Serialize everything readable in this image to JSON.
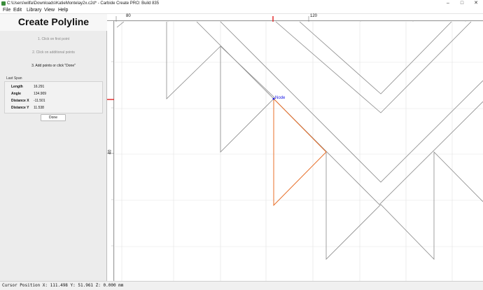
{
  "window": {
    "title": "C:\\Users\\wilfa\\Downloads\\KatieMontelay2x.c2d* - Carbide Create PRO: Build 835",
    "controls": {
      "minimize": "–",
      "maximize": "□",
      "close": "✕"
    },
    "icon": "carbide-create-app-icon"
  },
  "menu": {
    "file": "File",
    "edit": "Edit",
    "library": "Library",
    "view": "View",
    "help": "Help"
  },
  "panel": {
    "title": "Create Polyline",
    "steps": [
      "1. Click on first point",
      "2. Click on additional points",
      "3. Add points or click \"Done\""
    ],
    "active_step": 3,
    "last_span": {
      "title": "Last Span",
      "rows": [
        {
          "label": "Length",
          "value": "16.291"
        },
        {
          "label": "Angle",
          "value": "134.909"
        },
        {
          "label": "Distance X",
          "value": "-11.501"
        },
        {
          "label": "Distance Y",
          "value": "11.538"
        }
      ]
    },
    "done_label": "Done"
  },
  "rulers": {
    "horizontal_labels": [
      "80",
      "120"
    ],
    "vertical_labels": [
      "40"
    ],
    "marker_color": "#e02020"
  },
  "canvas": {
    "node_label": "Node",
    "geometry_color": "#8a8a8a",
    "grid_color": "#e2e2e2",
    "active_path_color": "#e8702a"
  },
  "status": {
    "text": "Cursor Position X: 111.498 Y: 51.961 Z: 0.000 mm"
  }
}
